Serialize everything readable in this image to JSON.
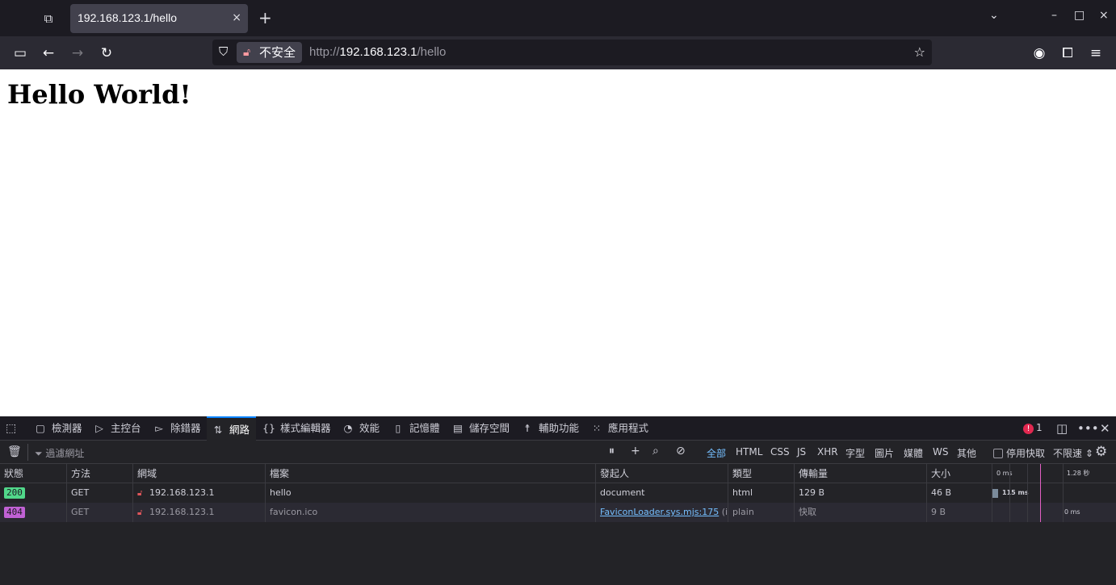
{
  "browser": {
    "tab_title": "192.168.123.1/hello",
    "tab_close": "×",
    "new_tab": "+",
    "window_controls": {
      "minimize": "–",
      "maximize": "□",
      "close": "×"
    },
    "url_scheme": "http://",
    "url_host": "192.168.123.1",
    "url_path": "/hello",
    "security_label": "不安全"
  },
  "page": {
    "heading": "Hello World!"
  },
  "devtools": {
    "tabs": [
      {
        "label": "檢測器",
        "icon": "inspector-icon"
      },
      {
        "label": "主控台",
        "icon": "console-icon"
      },
      {
        "label": "除錯器",
        "icon": "debugger-icon"
      },
      {
        "label": "網路",
        "icon": "network-icon"
      },
      {
        "label": "樣式編輯器",
        "icon": "style-editor-icon"
      },
      {
        "label": "效能",
        "icon": "performance-icon"
      },
      {
        "label": "記憶體",
        "icon": "memory-icon"
      },
      {
        "label": "儲存空間",
        "icon": "storage-icon"
      },
      {
        "label": "輔助功能",
        "icon": "accessibility-icon"
      },
      {
        "label": "應用程式",
        "icon": "application-icon"
      }
    ],
    "active_tab": "網路",
    "error_count": "1",
    "filter_placeholder": "過濾網址",
    "type_filters": [
      "全部",
      "HTML",
      "CSS",
      "JS",
      "XHR",
      "字型",
      "圖片",
      "媒體",
      "WS",
      "其他"
    ],
    "active_type_filter": "全部",
    "disable_cache": "停用快取",
    "throttle": "不限速",
    "columns": [
      "狀態",
      "方法",
      "網域",
      "檔案",
      "發起人",
      "類型",
      "傳輸量",
      "大小"
    ],
    "waterfall_ticks": {
      "start": "0 ms",
      "end": "1.28 秒"
    },
    "requests": [
      {
        "status": "200",
        "method": "GET",
        "domain": "192.168.123.1",
        "file": "hello",
        "initiator": "document",
        "initiator_suffix": "",
        "type": "html",
        "transferred": "129 B",
        "size": "46 B",
        "timing": "115 ms"
      },
      {
        "status": "404",
        "method": "GET",
        "domain": "192.168.123.1",
        "file": "favicon.ico",
        "initiator": "FaviconLoader.sys.mjs:175",
        "initiator_suffix": " (i...",
        "type": "plain",
        "transferred": "快取",
        "size": "9 B",
        "timing": "0 ms"
      }
    ]
  }
}
